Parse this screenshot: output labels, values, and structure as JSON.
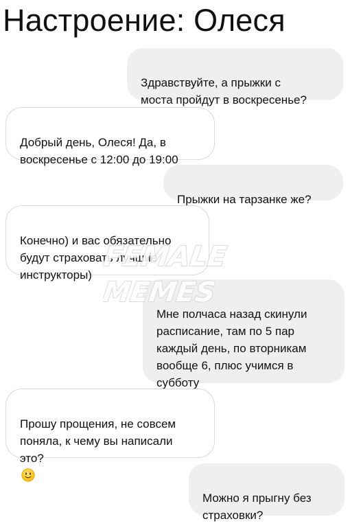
{
  "title": "Настроение: Олеся",
  "watermark": {
    "line1": "FEMALE",
    "line2": "MEMES"
  },
  "messages": [
    {
      "side": "out",
      "text": "Здравствуйте, а прыжки с\nмоста пройдут в воскресенье?"
    },
    {
      "side": "in",
      "text": "Добрый день, Олеся! Да, в\nвоскресенье с 12:00 до 19:00"
    },
    {
      "side": "out",
      "text": "Прыжки на тарзанке же?"
    },
    {
      "side": "in",
      "text": "Конечно) и вас обязательно\nбудут страховать лучшие\nинструкторы)"
    },
    {
      "side": "out",
      "text": "Мне полчаса назад скинули\nрасписание, там по 5 пар\nкаждый день, по вторникам\nвообще 6, плюс учимся в\nсубботу"
    },
    {
      "side": "in",
      "text": "Прошу прощения, не совсем\nпоняла, к чему вы написали\nэто?",
      "emoji": "slightly-smiling-face-icon"
    },
    {
      "side": "out",
      "text": "Можно я прыгну без\nстраховки?"
    }
  ]
}
